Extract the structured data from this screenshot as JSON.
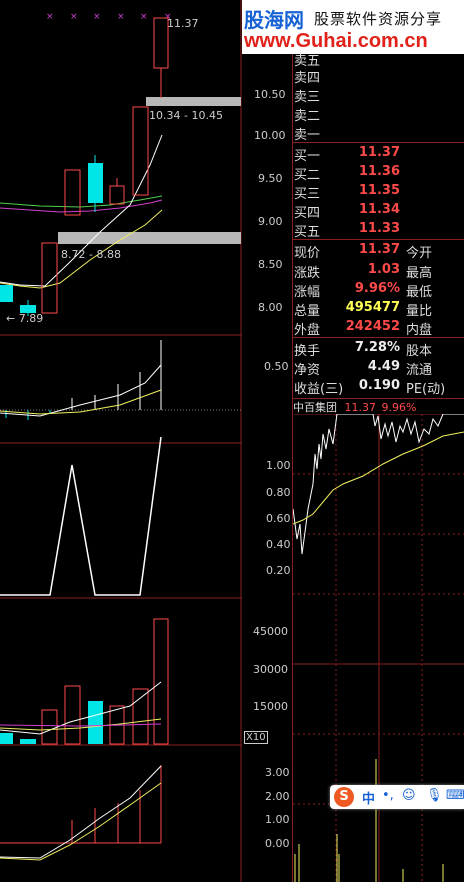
{
  "banner": {
    "logo": "股海网",
    "slogan": "股票软件资源分享",
    "url": "www.Guhai.com.cn"
  },
  "price_axis": [
    "10.50",
    "10.00",
    "9.50",
    "9.00",
    "8.50",
    "8.00"
  ],
  "price_annotations": {
    "high": "11.37",
    "gap_upper": "10.34 - 10.45",
    "gap_lower": "8.72 - 8.88",
    "low": "7.89"
  },
  "indicator1_axis": [
    "0.50"
  ],
  "indicator2_axis": [
    "1.00",
    "0.80",
    "0.60",
    "0.40",
    "0.20"
  ],
  "volume_axis": [
    "45000",
    "30000",
    "15000"
  ],
  "volume_unit": "X10",
  "indicator4_axis": [
    "3.00",
    "2.00",
    "1.00",
    "0.00"
  ],
  "order_book": {
    "sell": [
      {
        "label": "卖五"
      },
      {
        "label": "卖四"
      },
      {
        "label": "卖三"
      },
      {
        "label": "卖二"
      },
      {
        "label": "卖一"
      }
    ],
    "buy": [
      {
        "label": "买一",
        "price": "11.37"
      },
      {
        "label": "买二",
        "price": "11.36"
      },
      {
        "label": "买三",
        "price": "11.35"
      },
      {
        "label": "买四",
        "price": "11.34"
      },
      {
        "label": "买五",
        "price": "11.33"
      }
    ]
  },
  "quote": {
    "current_label": "现价",
    "current": "11.37",
    "open_label": "今开",
    "change_label": "涨跌",
    "change": "1.03",
    "high_label": "最高",
    "pct_label": "涨幅",
    "pct": "9.96%",
    "low_label": "最低",
    "volume_label": "总量",
    "volume": "495477",
    "ratio_label": "量比",
    "outer_label": "外盘",
    "outer": "242452",
    "inner_label": "内盘"
  },
  "fundamentals": {
    "turnover_label": "换手",
    "turnover": "7.28%",
    "capital_label": "股本",
    "netasset_label": "净资",
    "netasset": "4.49",
    "float_label": "流通",
    "eps_label": "收益(三)",
    "eps": "0.190",
    "pe_label": "PE(动)"
  },
  "mini_chart": {
    "name": "中百集团",
    "price": "11.37",
    "pct": "9.96%"
  },
  "ime_bar": {
    "lang": "中"
  },
  "colors": {
    "up": "#ff4a4a",
    "down": "#00e5e5",
    "ma_yellow": "#f0f060",
    "ma_white": "#ffffff",
    "ma_magenta": "#d040d0"
  }
}
